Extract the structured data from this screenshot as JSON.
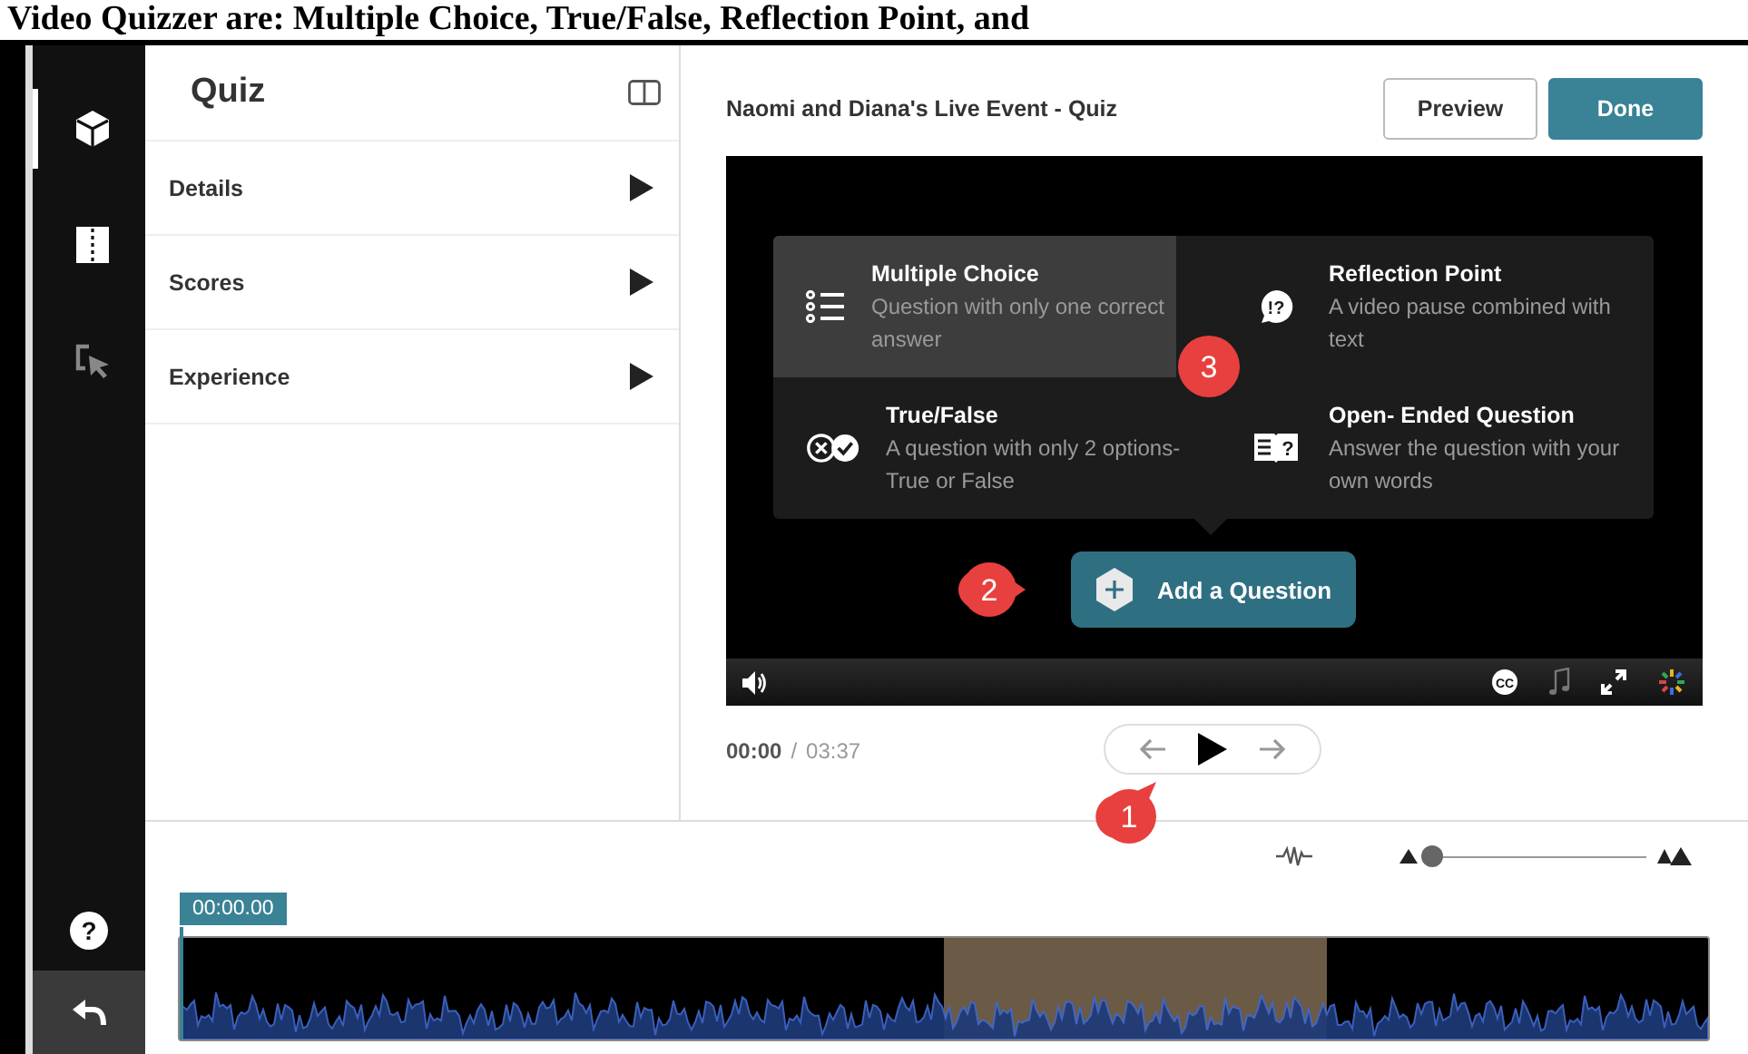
{
  "document_heading": "Video Quizzer are: Multiple Choice, True/False, Reflection Point, and",
  "rail": {
    "items": [
      {
        "kind": "cube",
        "selected": true
      },
      {
        "kind": "book",
        "selected": false
      },
      {
        "kind": "cursor",
        "selected": false
      }
    ],
    "help_glyph": "?"
  },
  "panel": {
    "title": "Quiz",
    "sections": [
      {
        "label": "Details"
      },
      {
        "label": "Scores"
      },
      {
        "label": "Experience"
      }
    ]
  },
  "header": {
    "title": "Naomi and Diana's Live Event - Quiz",
    "buttons": [
      {
        "label": "Preview",
        "kind": "secondary"
      },
      {
        "label": "Done",
        "kind": "primary"
      }
    ]
  },
  "question_menu": {
    "options": [
      {
        "kind": "multiple-choice",
        "title": "Multiple Choice",
        "description": "Question with only one correct answer",
        "selected": true
      },
      {
        "kind": "reflection",
        "icon_glyph": "!?",
        "title": "Reflection Point",
        "description": "A video pause combined with text",
        "selected": false
      },
      {
        "kind": "true-false",
        "title": "True/False",
        "description": "A question with only 2 options- True or False",
        "selected": false
      },
      {
        "kind": "open-ended",
        "icon_glyph": "?",
        "title": "Open- Ended Question",
        "description": "Answer the question with your own words",
        "selected": false
      }
    ]
  },
  "add_question_button": "Add a Question",
  "video_controls": {
    "captions_glyph": "CC"
  },
  "playback": {
    "current": "00:00",
    "separator": "/",
    "duration": "03:37"
  },
  "timeline": {
    "zoom": {
      "level": 0.02
    },
    "time_tag": "00:00.00"
  },
  "callouts": [
    {
      "number": "1"
    },
    {
      "number": "2"
    },
    {
      "number": "3"
    }
  ]
}
